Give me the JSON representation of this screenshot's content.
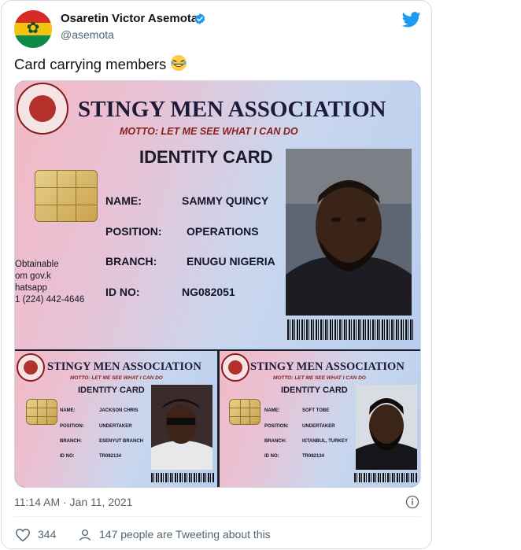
{
  "author": {
    "name": "Osaretin Victor Asemota",
    "handle": "@asemota",
    "avatar_icon": "ghana-flag-leaf-avatar",
    "verified_icon": "verified-badge-icon"
  },
  "tweet": {
    "text": "Card carrying members",
    "emoji": "😂",
    "timestamp": "11:14 AM · Jan 11, 2021"
  },
  "engagement": {
    "likes": "344",
    "discussion": "147 people are Tweeting about this"
  },
  "media": {
    "big_card": {
      "association": "STINGY MEN ASSOCIATION",
      "motto": "MOTTO: LET ME SEE WHAT I CAN DO",
      "card_title": "IDENTITY CARD",
      "fields": [
        {
          "label": "NAME:",
          "value": "SAMMY QUINCY"
        },
        {
          "label": "POSITION:",
          "value": "OPERATIONS"
        },
        {
          "label": "BRANCH:",
          "value": "ENUGU NIGERIA"
        },
        {
          "label": "ID NO:",
          "value": "NG082051"
        }
      ],
      "side_text": [
        "Obtainable",
        "om gov.k",
        "hatsapp",
        "1 (224) 442-4646"
      ]
    },
    "small_cards": [
      {
        "association": "STINGY MEN ASSOCIATION",
        "motto": "MOTTO: LET ME SEE WHAT I CAN DO",
        "card_title": "IDENTITY CARD",
        "fields": [
          {
            "label": "NAME:",
            "value": "JACKSON CHRIS"
          },
          {
            "label": "POSITION:",
            "value": "UNDERTAKER"
          },
          {
            "label": "BRANCH:",
            "value": "ESENYUT BRANCH"
          },
          {
            "label": "ID NO:",
            "value": "TR082134"
          }
        ]
      },
      {
        "association": "STINGY MEN ASSOCIATION",
        "motto": "MOTTO: LET ME SEE WHAT I CAN DO",
        "card_title": "IDENTITY CARD",
        "fields": [
          {
            "label": "NAME:",
            "value": "SOFT TOBE"
          },
          {
            "label": "POSITION:",
            "value": "UNDERTAKER"
          },
          {
            "label": "BRANCH:",
            "value": "ISTANBUL, TURKEY"
          },
          {
            "label": "ID NO:",
            "value": "TR082134"
          }
        ]
      }
    ]
  },
  "colors": {
    "text_primary": "#0f1419",
    "text_secondary": "#536471",
    "twitter_blue": "#1d9bf0",
    "border": "#cfd9de"
  }
}
